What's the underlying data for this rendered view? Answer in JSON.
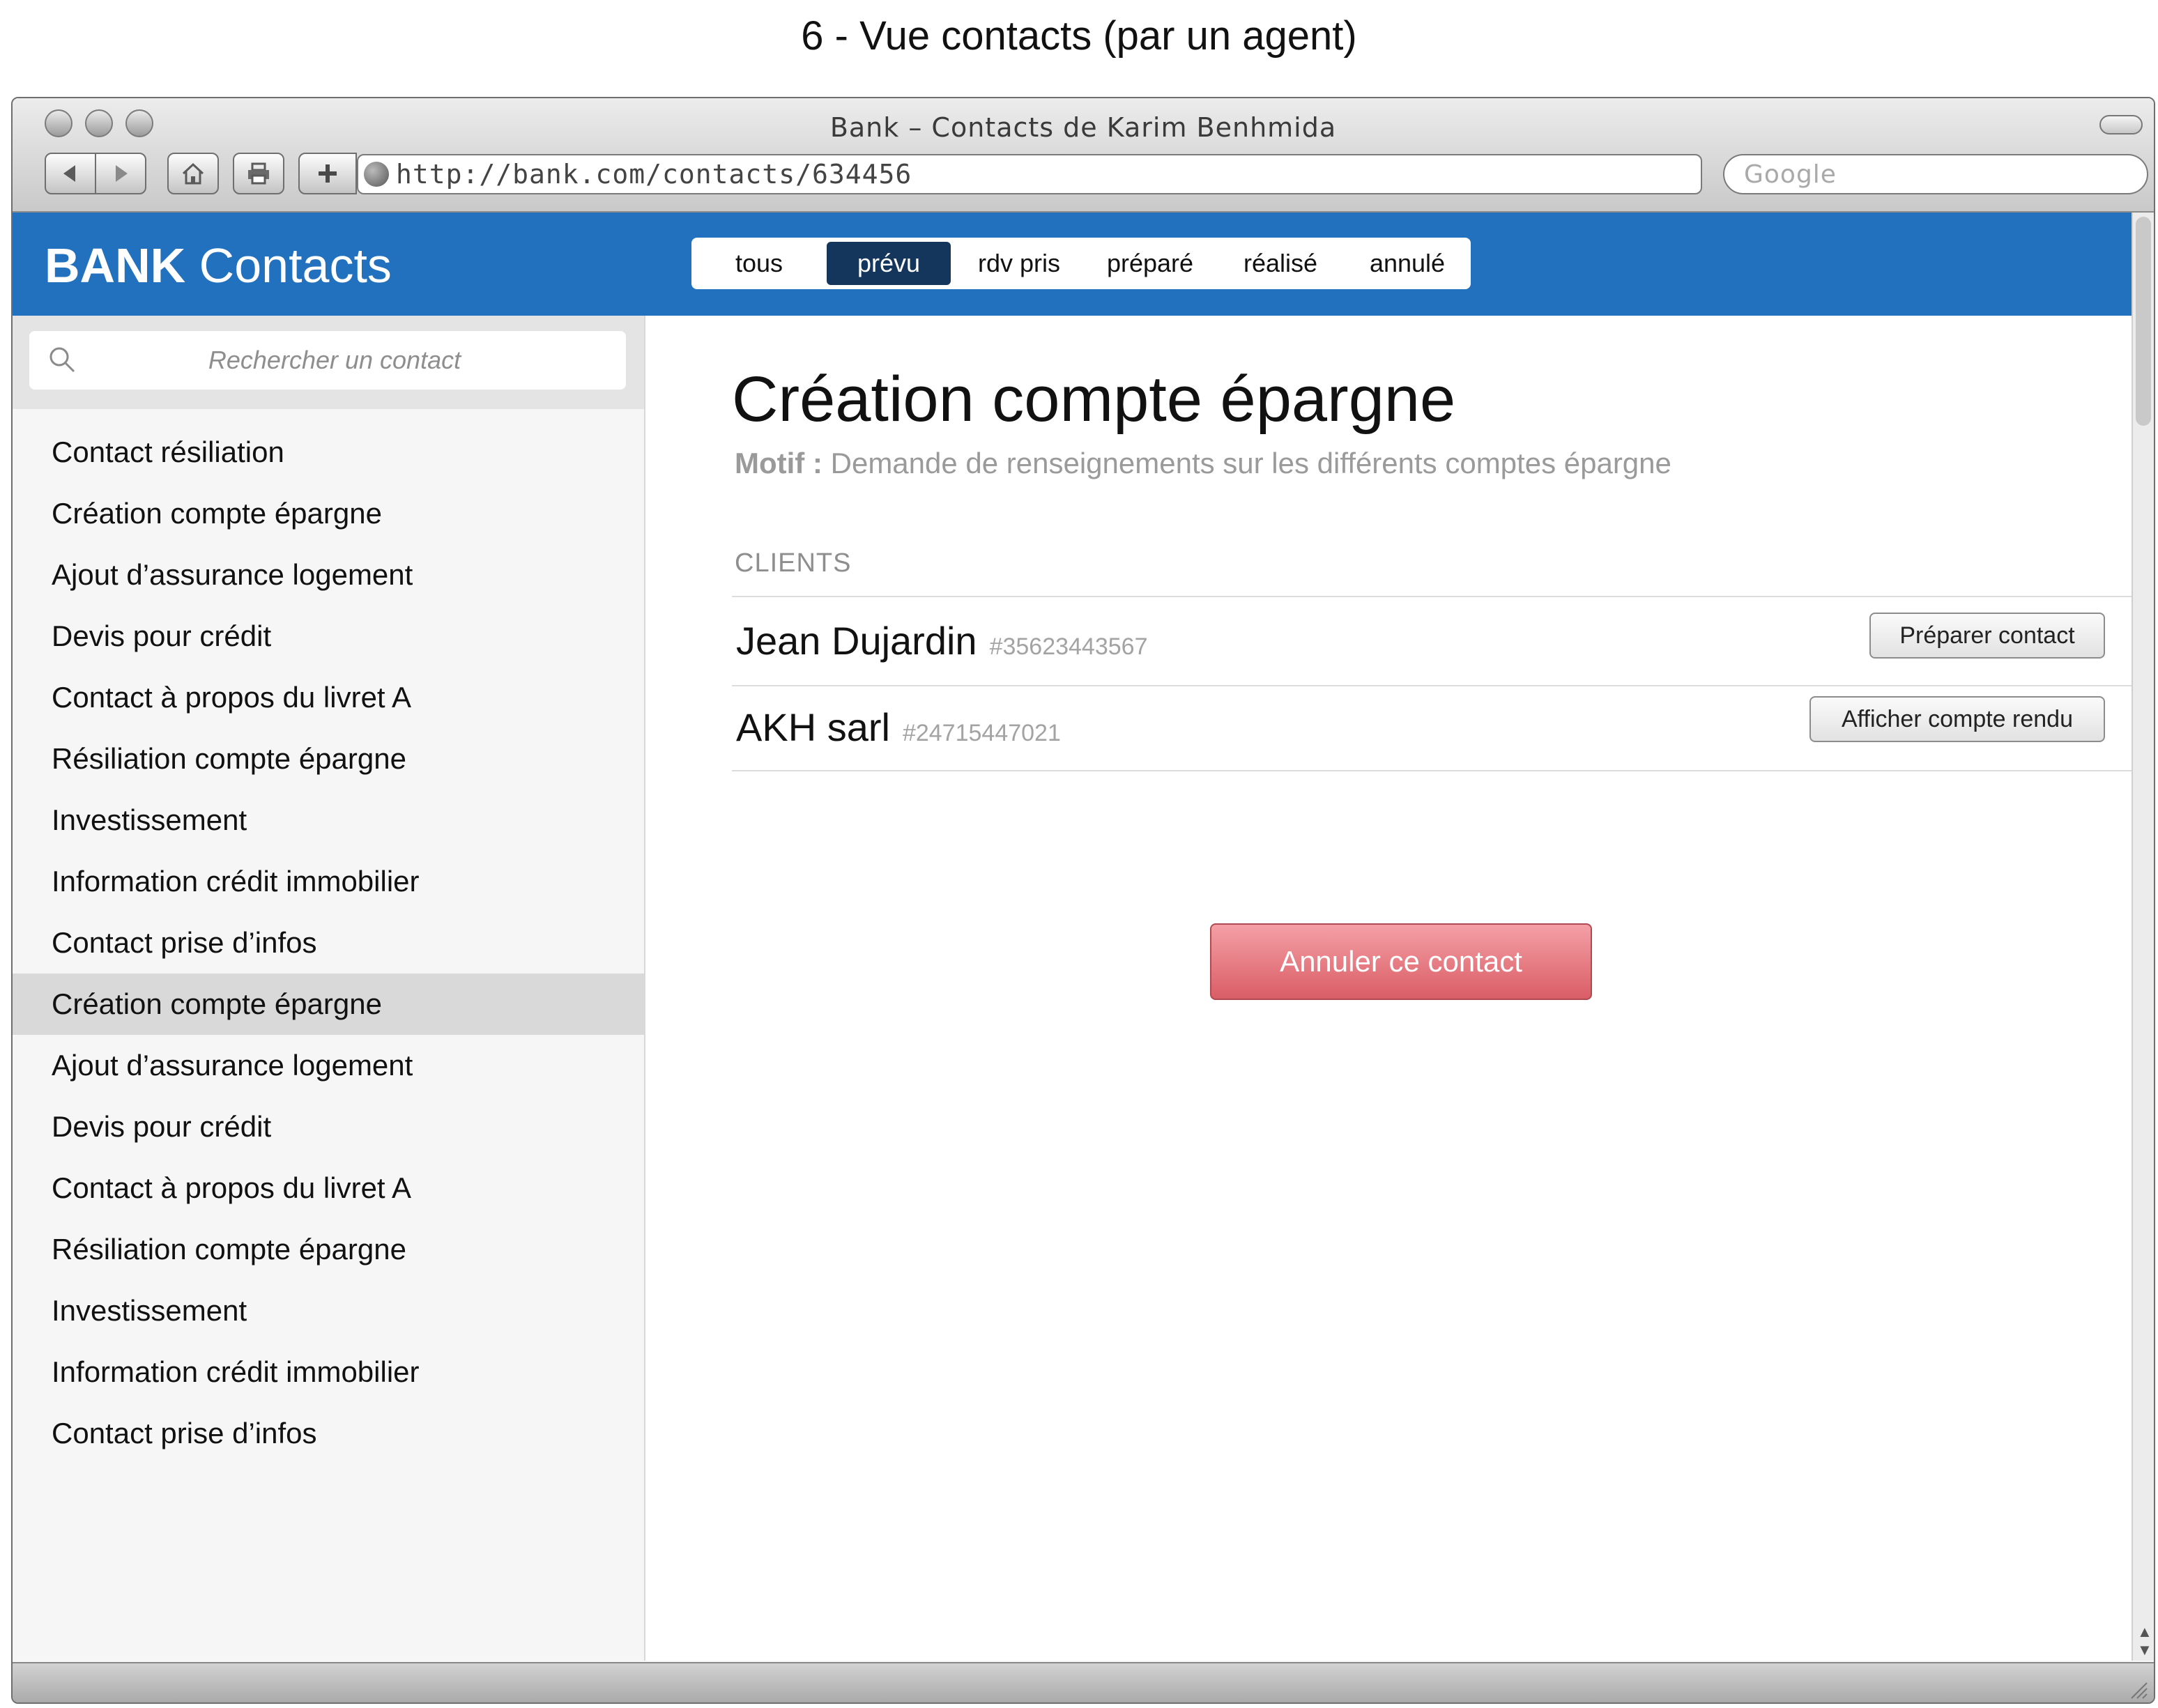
{
  "caption": "6 - Vue contacts (par un agent)",
  "browser": {
    "window_title": "Bank – Contacts de Karim Benhmida",
    "url": "http://bank.com/contacts/634456",
    "search_placeholder": "Google"
  },
  "app": {
    "brand_bold": "BANK",
    "brand_light": "Contacts",
    "tabs": [
      {
        "label": "tous",
        "active": false
      },
      {
        "label": "prévu",
        "active": true
      },
      {
        "label": "rdv pris",
        "active": false
      },
      {
        "label": "préparé",
        "active": false
      },
      {
        "label": "réalisé",
        "active": false
      },
      {
        "label": "annulé",
        "active": false
      }
    ]
  },
  "sidebar": {
    "search_placeholder": "Rechercher un contact",
    "items": [
      {
        "label": "Contact résiliation",
        "selected": false
      },
      {
        "label": "Création compte épargne",
        "selected": false
      },
      {
        "label": "Ajout d’assurance logement",
        "selected": false
      },
      {
        "label": "Devis pour crédit",
        "selected": false
      },
      {
        "label": "Contact à propos du livret A",
        "selected": false
      },
      {
        "label": "Résiliation compte épargne",
        "selected": false
      },
      {
        "label": "Investissement",
        "selected": false
      },
      {
        "label": "Information crédit immobilier",
        "selected": false
      },
      {
        "label": "Contact prise d’infos",
        "selected": false
      },
      {
        "label": "Création compte épargne",
        "selected": true
      },
      {
        "label": "Ajout d’assurance logement",
        "selected": false
      },
      {
        "label": "Devis pour crédit",
        "selected": false
      },
      {
        "label": "Contact à propos du livret A",
        "selected": false
      },
      {
        "label": "Résiliation compte épargne",
        "selected": false
      },
      {
        "label": "Investissement",
        "selected": false
      },
      {
        "label": "Information crédit immobilier",
        "selected": false
      },
      {
        "label": "Contact prise d’infos",
        "selected": false
      }
    ]
  },
  "detail": {
    "title": "Création compte épargne",
    "motif_label": "Motif :",
    "motif_text": "Demande de renseignements sur les différents comptes épargne",
    "clients_label": "CLIENTS",
    "clients": [
      {
        "first": "Jean",
        "last": "Dujardin",
        "id": "#35623443567",
        "action": "Préparer contact"
      },
      {
        "first": "AKH",
        "last": "sarl",
        "id": "#24715447021",
        "action": "Afficher compte rendu"
      }
    ],
    "cancel_label": "Annuler ce contact"
  },
  "colors": {
    "appbar": "#2171be",
    "active_tab": "#15365c",
    "cancel_button": "#e8737b"
  }
}
